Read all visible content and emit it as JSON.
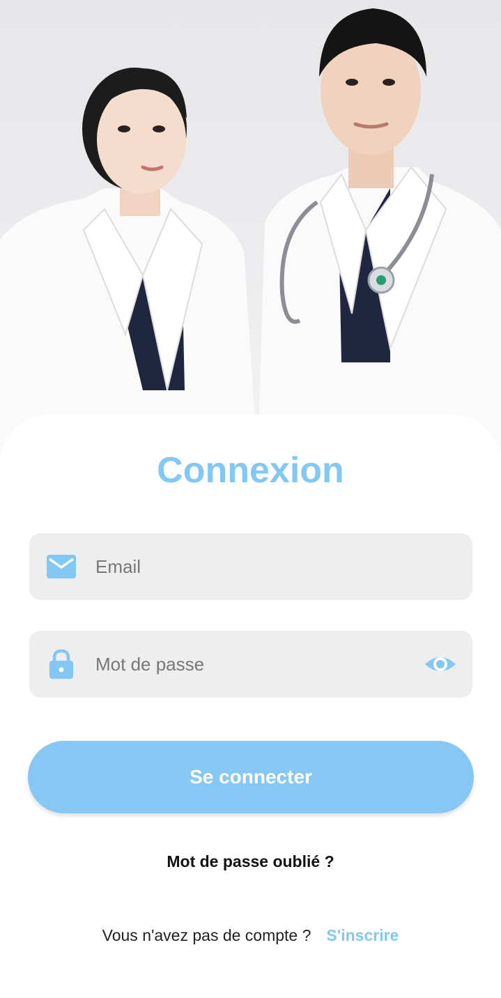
{
  "hero": {
    "image": "two-doctors-in-white-coats-photo"
  },
  "login": {
    "title": "Connexion",
    "email": {
      "placeholder": "Email",
      "icon": "mail-icon"
    },
    "password": {
      "placeholder": "Mot de passe",
      "icon": "lock-icon",
      "toggle_icon": "eye-icon"
    },
    "submit_label": "Se connecter",
    "forgot_label": "Mot de passe oublié ?",
    "signup_prompt": "Vous n'avez pas de compte ?",
    "signup_link": "S'inscrire"
  },
  "colors": {
    "accent": "#83c8f4",
    "button": "#86c7f3",
    "field_bg": "#eeeeee"
  }
}
